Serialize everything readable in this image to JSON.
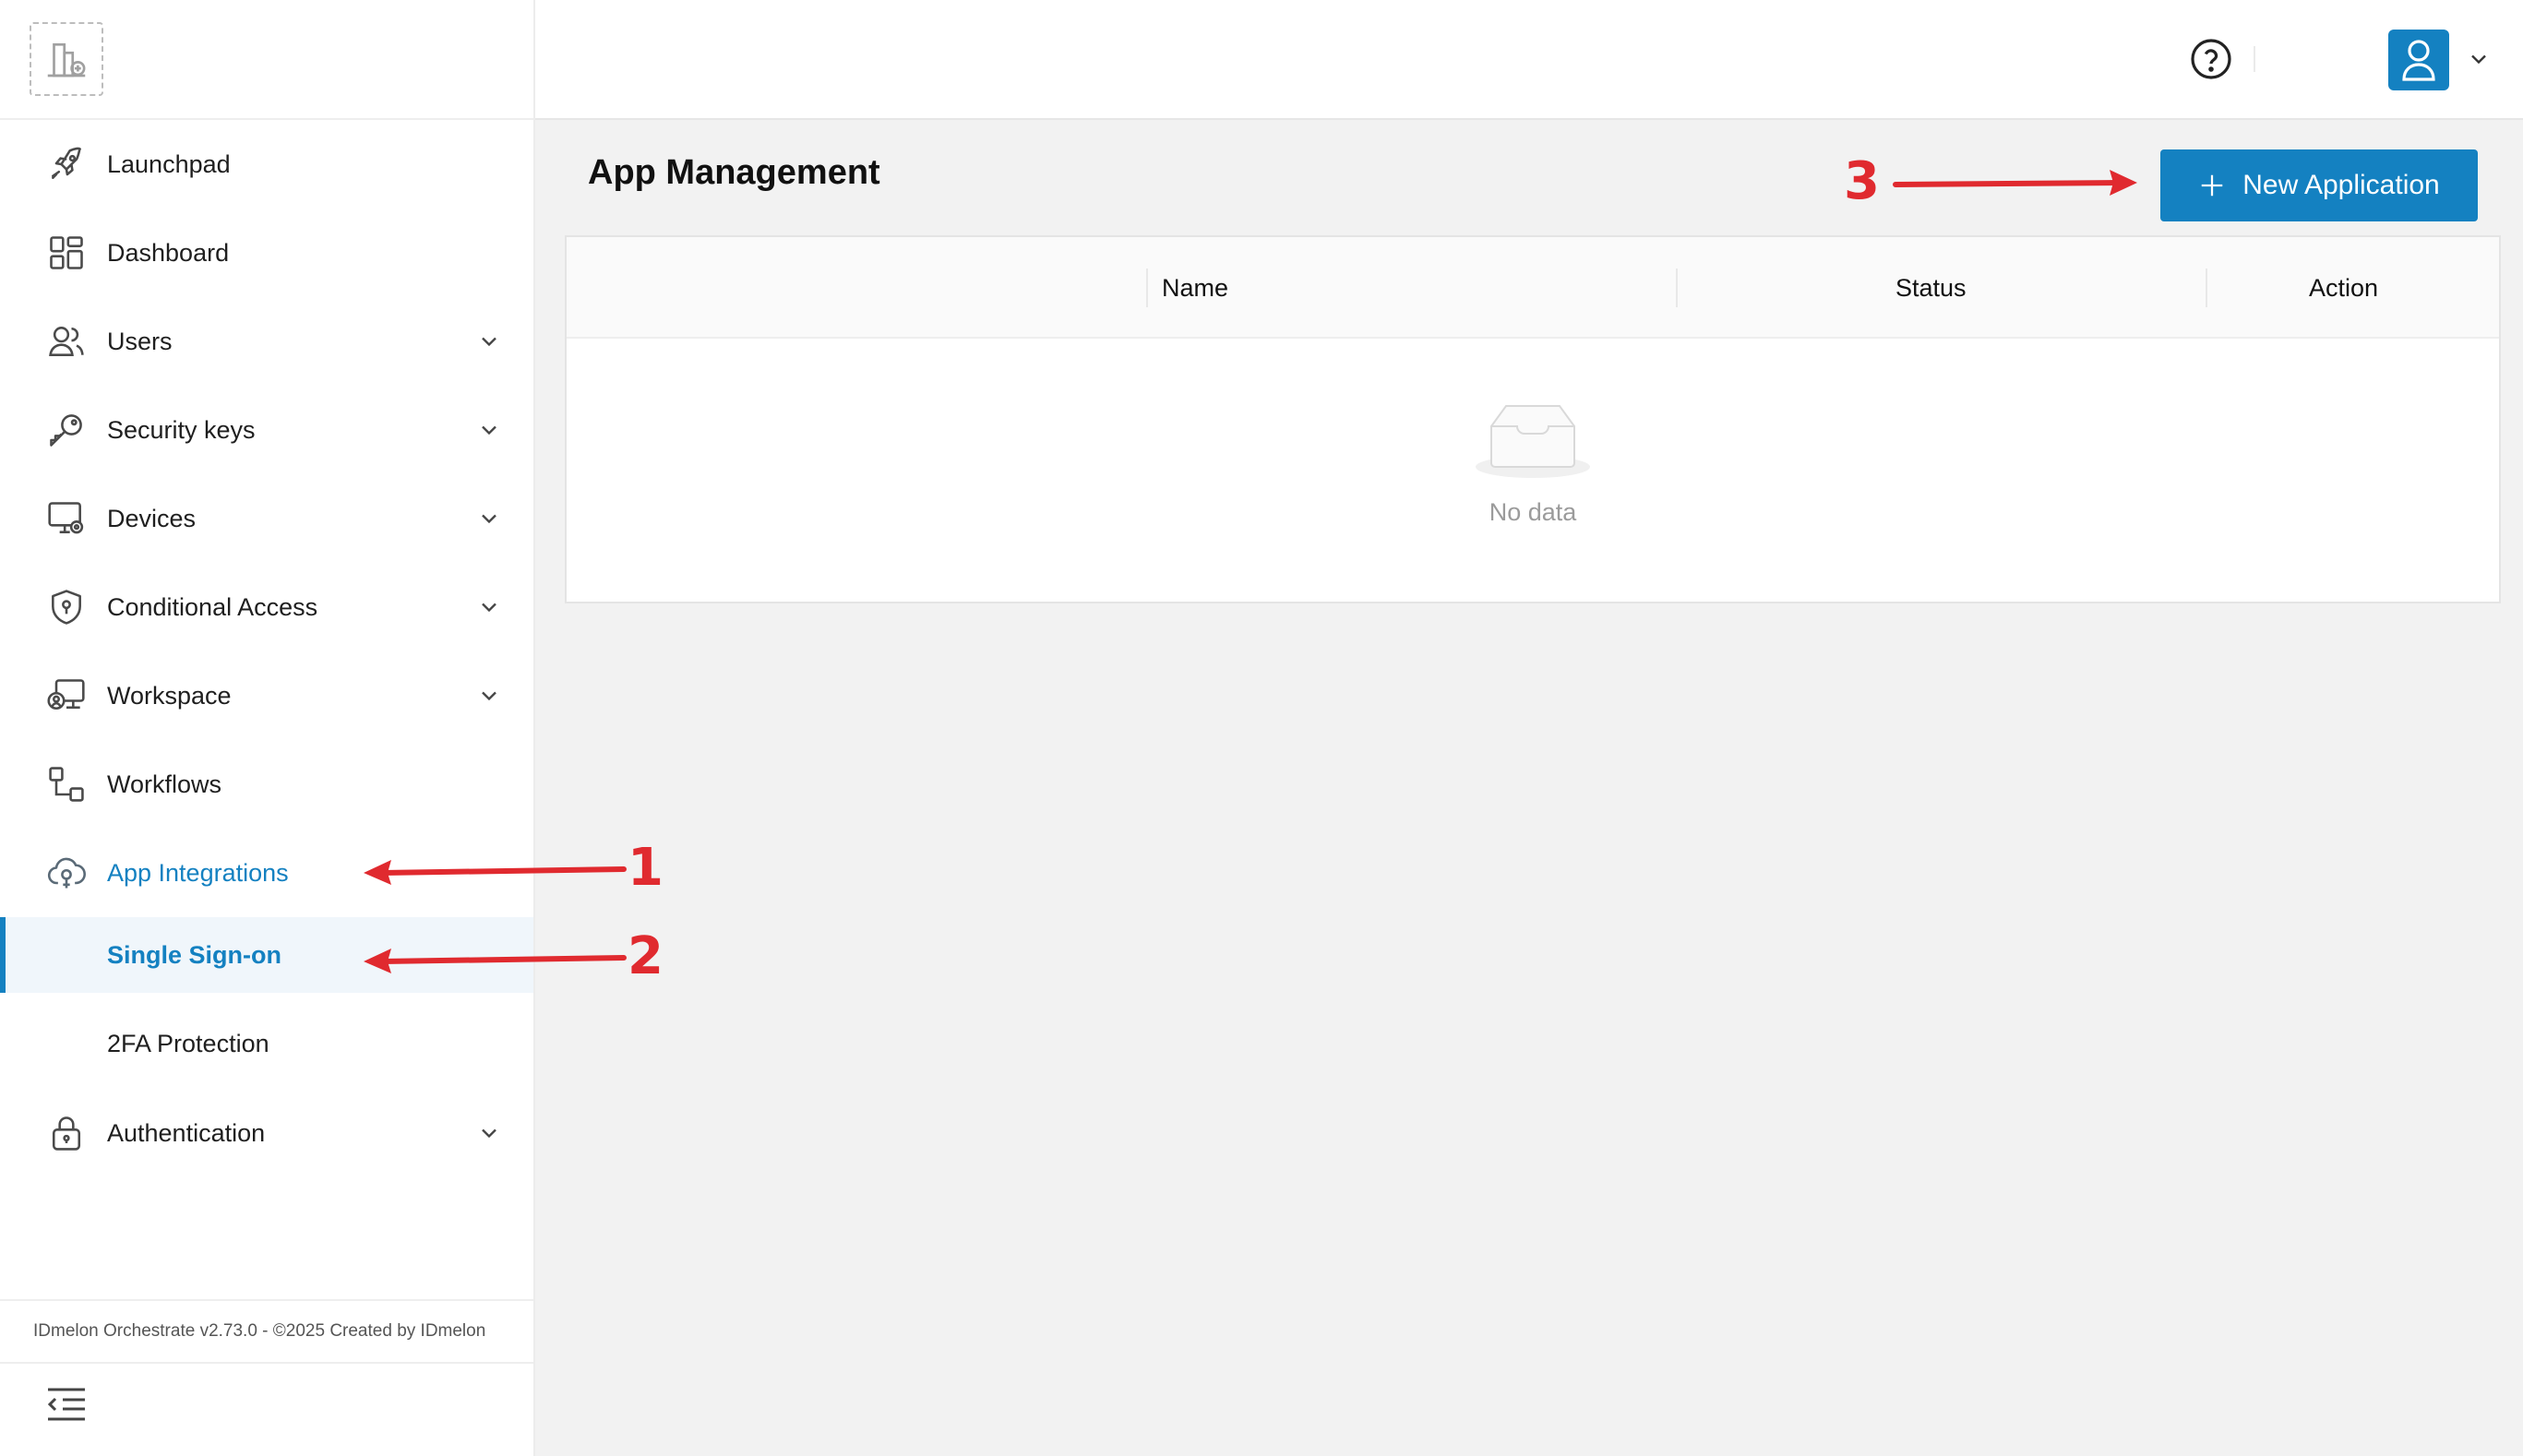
{
  "sidebar": {
    "items": [
      {
        "label": "Launchpad",
        "icon": "rocket-icon"
      },
      {
        "label": "Dashboard",
        "icon": "dashboard-icon"
      },
      {
        "label": "Users",
        "icon": "users-icon"
      },
      {
        "label": "Security keys",
        "icon": "key-icon"
      },
      {
        "label": "Devices",
        "icon": "devices-icon"
      },
      {
        "label": "Conditional Access",
        "icon": "shield-icon"
      },
      {
        "label": "Workspace",
        "icon": "workspace-icon"
      },
      {
        "label": "Workflows",
        "icon": "workflow-icon"
      },
      {
        "label": "App Integrations",
        "icon": "cloud-icon"
      },
      {
        "label": "Authentication",
        "icon": "lock-icon"
      }
    ],
    "sub_items": [
      {
        "label": "Single Sign-on"
      },
      {
        "label": "2FA Protection"
      }
    ],
    "footer": "IDmelon Orchestrate v2.73.0 - ©2025 Created by IDmelon"
  },
  "main": {
    "title": "App Management",
    "new_button_label": "New Application",
    "table": {
      "columns": [
        "Name",
        "Status",
        "Action"
      ],
      "empty_text": "No data"
    }
  },
  "annotations": [
    "1",
    "2",
    "3"
  ],
  "colors": {
    "accent": "#1481c1",
    "annotation": "#e02a2f",
    "background": "#f2f2f2"
  }
}
